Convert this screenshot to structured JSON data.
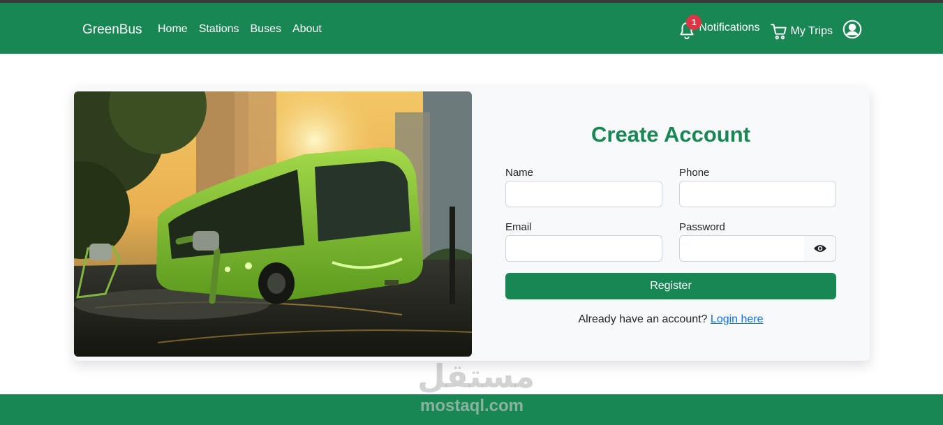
{
  "navbar": {
    "brand": "GreenBus",
    "links": [
      "Home",
      "Stations",
      "Buses",
      "About"
    ],
    "notifications_label": "Notifications",
    "notifications_count": "1",
    "trips_label": "My Trips",
    "icons": [
      "bell-icon",
      "cart-icon",
      "user-circle-icon"
    ]
  },
  "form": {
    "title": "Create Account",
    "name_label": "Name",
    "phone_label": "Phone",
    "email_label": "Email",
    "password_label": "Password",
    "name_value": "",
    "phone_value": "",
    "email_value": "",
    "password_value": "",
    "register_label": "Register",
    "login_prompt": "Already have an account?",
    "login_link": "Login here"
  },
  "watermark": {
    "arabic": "مستقل",
    "latin": "mostaql.com"
  },
  "colors": {
    "primary": "#198754",
    "badge": "#dc3545",
    "link": "#0d6efd",
    "card_bg": "#f8f9fa"
  }
}
